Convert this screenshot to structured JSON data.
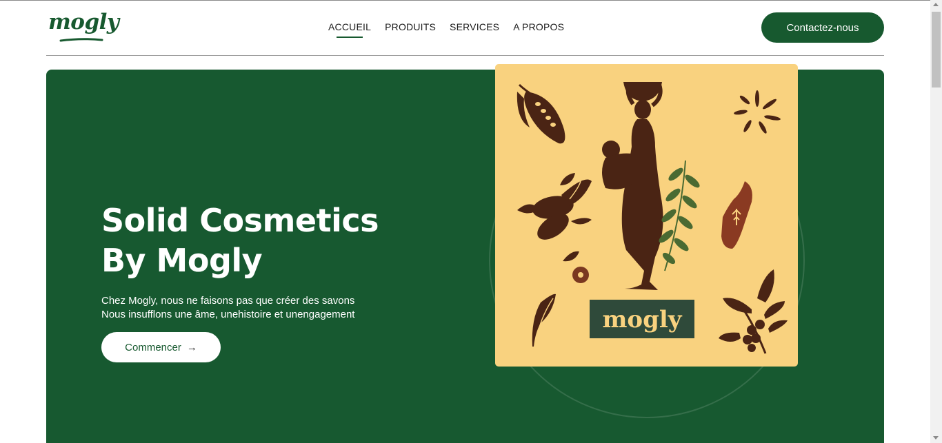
{
  "brand": {
    "name": "mogly",
    "color": "#17592f"
  },
  "nav": {
    "items": [
      {
        "label": "ACCUEIL",
        "active": true
      },
      {
        "label": "PRODUITS",
        "active": false
      },
      {
        "label": "SERVICES",
        "active": false
      },
      {
        "label": "A PROPOS",
        "active": false
      }
    ]
  },
  "header": {
    "contact_label": "Contactez-nous"
  },
  "hero": {
    "title_line1": "Solid Cosmetics",
    "title_line2": "By Mogly",
    "subtitle_line1": "Chez Mogly, nous ne faisons pas que créer des savons",
    "subtitle_line2": "Nous insufflons une âme, unehistoire et unengagement",
    "cta_label": "Commencer",
    "cta_icon": "arrow-right-icon"
  },
  "poster": {
    "label": "mogly",
    "background": "#f9d27f",
    "ink": "#4a2414",
    "label_bg": "#2f4a3a",
    "label_color": "#f9d27f"
  },
  "colors": {
    "hero_bg": "#175930",
    "accent": "#17592f",
    "white": "#ffffff"
  }
}
